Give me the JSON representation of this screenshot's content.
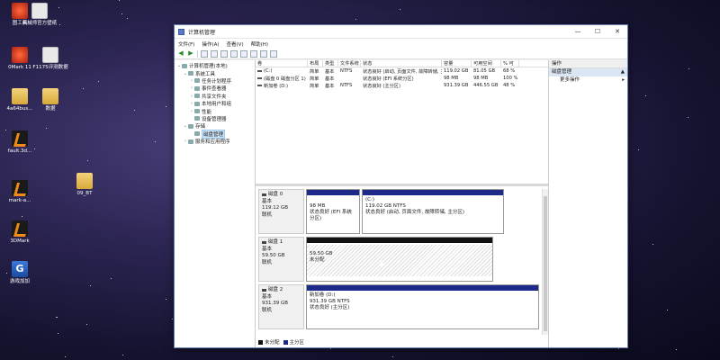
{
  "desktop": {
    "icons": [
      {
        "label": "图工具",
        "kind": "app-red"
      },
      {
        "label": "机械师官方壁纸",
        "kind": "doc"
      },
      {
        "label": "0Mark 11",
        "kind": "app-red"
      },
      {
        "label": "F1175评测数据",
        "kind": "doc"
      },
      {
        "label": "4a64bus...",
        "kind": "folder"
      },
      {
        "label": "数据",
        "kind": "folder"
      },
      {
        "label": "fault.3d...",
        "kind": "app-orange"
      },
      {
        "label": "09_BT",
        "kind": "folder"
      },
      {
        "label": "mark-a...",
        "kind": "app-orange"
      },
      {
        "label": "3DMark",
        "kind": "app-orange"
      },
      {
        "label": "游戏加加",
        "kind": "app-blue"
      }
    ]
  },
  "window": {
    "title": "计算机管理",
    "controls": {
      "minimize": "—",
      "maximize": "☐",
      "close": "✕"
    },
    "menu": [
      "文件(F)",
      "操作(A)",
      "查看(V)",
      "帮助(H)"
    ]
  },
  "tree": [
    {
      "label": "计算机管理(本地)",
      "indent": 0,
      "exp": "⌄",
      "sel": false
    },
    {
      "label": "系统工具",
      "indent": 1,
      "exp": "⌄",
      "sel": false
    },
    {
      "label": "任务计划程序",
      "indent": 2,
      "exp": "›",
      "sel": false
    },
    {
      "label": "事件查看器",
      "indent": 2,
      "exp": "›",
      "sel": false
    },
    {
      "label": "共享文件夹",
      "indent": 2,
      "exp": "›",
      "sel": false
    },
    {
      "label": "本地用户和组",
      "indent": 2,
      "exp": "›",
      "sel": false
    },
    {
      "label": "性能",
      "indent": 2,
      "exp": "›",
      "sel": false
    },
    {
      "label": "设备管理器",
      "indent": 2,
      "exp": "",
      "sel": false
    },
    {
      "label": "存储",
      "indent": 1,
      "exp": "⌄",
      "sel": false
    },
    {
      "label": "磁盘管理",
      "indent": 2,
      "exp": "",
      "sel": true
    },
    {
      "label": "服务和应用程序",
      "indent": 1,
      "exp": "›",
      "sel": false
    }
  ],
  "volume_table": {
    "headers": [
      "卷",
      "布局",
      "类型",
      "文件系统",
      "状态",
      "容量",
      "可用空间",
      "% 可"
    ],
    "rows": [
      [
        "(C:)",
        "简单",
        "基本",
        "NTFS",
        "状态良好 (启动, 页面文件, 故障转储, 主分区)",
        "119.02 GB",
        "81.05 GB",
        "68 %"
      ],
      [
        "(磁盘 0 磁盘分区 1)",
        "简单",
        "基本",
        "",
        "状态良好 (EFI 系统分区)",
        "98 MB",
        "98 MB",
        "100 %"
      ],
      [
        "新加卷 (D:)",
        "简单",
        "基本",
        "NTFS",
        "状态良好 (主分区)",
        "931.39 GB",
        "446.55 GB",
        "48 %"
      ]
    ]
  },
  "disks": [
    {
      "name": "磁盘 0",
      "type": "基本",
      "size": "119.12 GB",
      "status": "联机",
      "partitions": [
        {
          "title": "",
          "line1": "98 MB",
          "line2": "状态良好 (EFI 系统分区)",
          "bar": "primary",
          "hatched": false
        },
        {
          "title": "(C:)",
          "line1": "119.02 GB NTFS",
          "line2": "状态良好 (启动, 页面文件, 故障转储, 主分区)",
          "bar": "primary",
          "hatched": false
        }
      ]
    },
    {
      "name": "磁盘 1",
      "type": "基本",
      "size": "59.50 GB",
      "status": "联机",
      "partitions": [
        {
          "title": "",
          "line1": "59.50 GB",
          "line2": "未分配",
          "bar": "unalloc",
          "hatched": true
        }
      ]
    },
    {
      "name": "磁盘 2",
      "type": "基本",
      "size": "931.39 GB",
      "status": "联机",
      "partitions": [
        {
          "title": "新加卷 (D:)",
          "line1": "931.39 GB NTFS",
          "line2": "状态良好 (主分区)",
          "bar": "primary",
          "hatched": false
        }
      ]
    }
  ],
  "legend": [
    {
      "label": "未分配",
      "color": "#111111"
    },
    {
      "label": "主分区",
      "color": "#1e2a8a"
    }
  ],
  "actions": {
    "header": "操作",
    "selected": "磁盘管理",
    "items": [
      "更多操作"
    ]
  }
}
